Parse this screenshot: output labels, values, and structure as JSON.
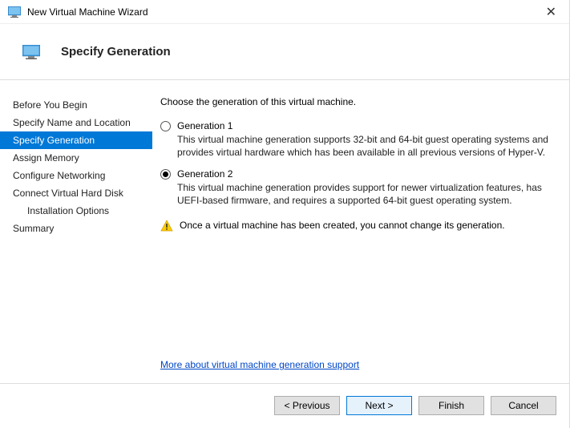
{
  "titlebar": {
    "title": "New Virtual Machine Wizard"
  },
  "header": {
    "title": "Specify Generation"
  },
  "sidebar": {
    "items": [
      {
        "label": "Before You Begin"
      },
      {
        "label": "Specify Name and Location"
      },
      {
        "label": "Specify Generation"
      },
      {
        "label": "Assign Memory"
      },
      {
        "label": "Configure Networking"
      },
      {
        "label": "Connect Virtual Hard Disk"
      },
      {
        "label": "Installation Options"
      },
      {
        "label": "Summary"
      }
    ]
  },
  "content": {
    "instruction": "Choose the generation of this virtual machine.",
    "gen1": {
      "label": "Generation 1",
      "desc": "This virtual machine generation supports 32-bit and 64-bit guest operating systems and provides virtual hardware which has been available in all previous versions of Hyper-V."
    },
    "gen2": {
      "label": "Generation 2",
      "desc": "This virtual machine generation provides support for newer virtualization features, has UEFI-based firmware, and requires a supported 64-bit guest operating system."
    },
    "warning": "Once a virtual machine has been created, you cannot change its generation.",
    "link": "More about virtual machine generation support"
  },
  "footer": {
    "previous": "< Previous",
    "next": "Next >",
    "finish": "Finish",
    "cancel": "Cancel"
  }
}
